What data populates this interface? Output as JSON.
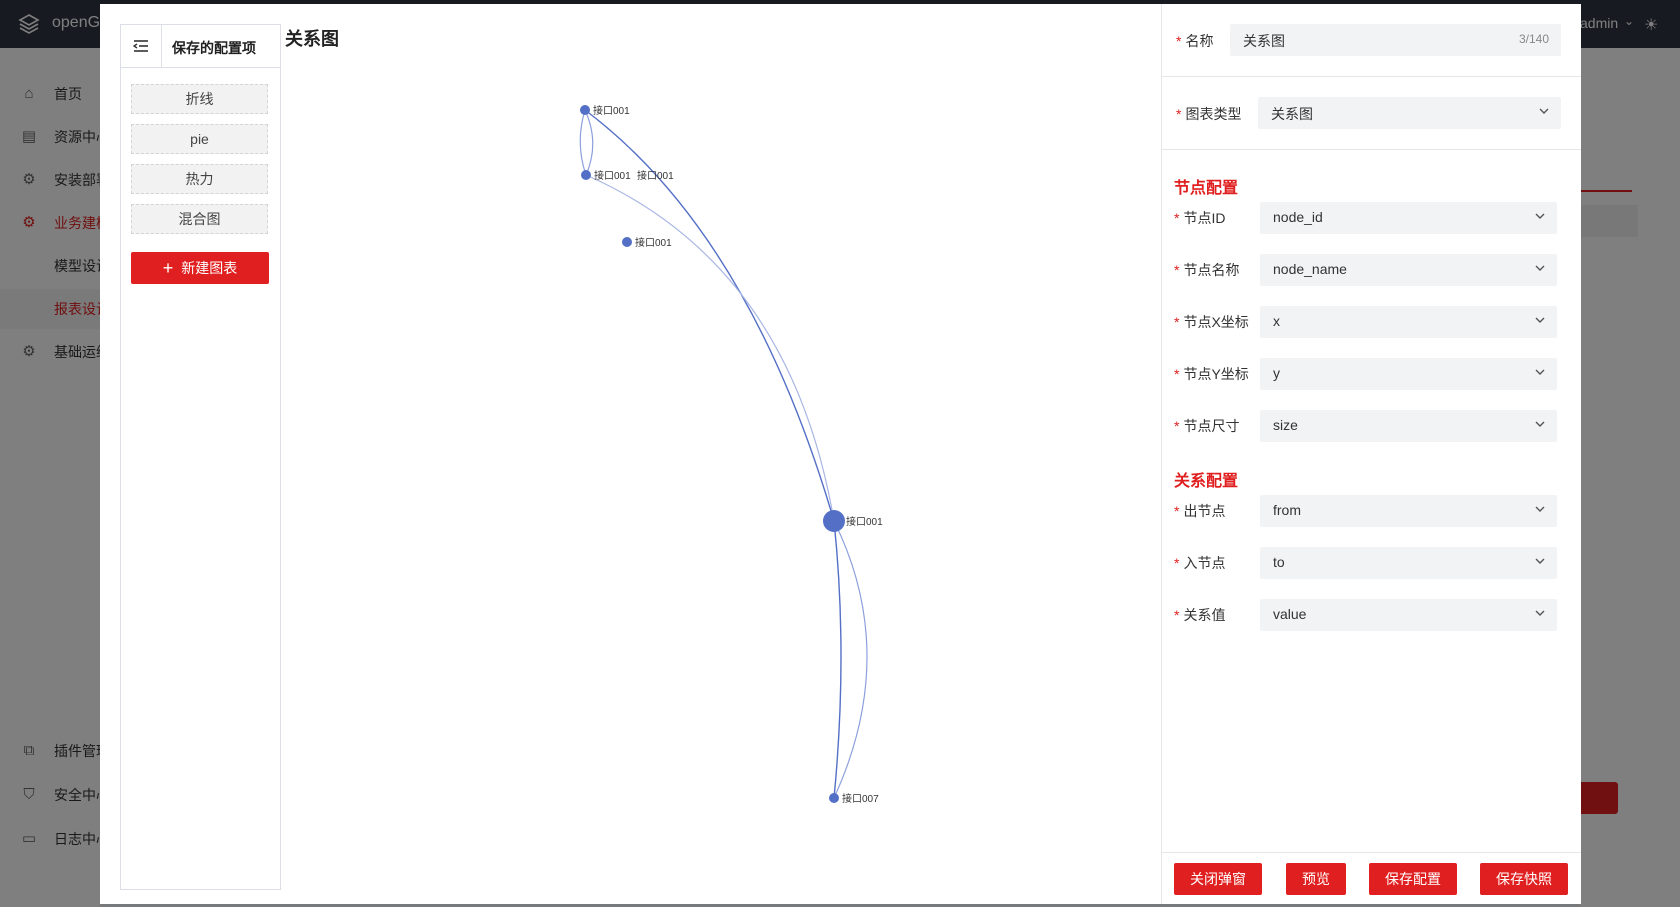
{
  "app": {
    "logo_text": "openG",
    "user": "admin"
  },
  "sidebar": {
    "items": [
      {
        "label": "首页",
        "icon": "home-icon"
      },
      {
        "label": "资源中心",
        "icon": "resource-icon"
      },
      {
        "label": "安装部署",
        "icon": "gear-icon"
      },
      {
        "label": "业务建模",
        "icon": "gear-icon"
      },
      {
        "label": "模型设计",
        "icon": ""
      },
      {
        "label": "报表设计",
        "icon": ""
      },
      {
        "label": "基础运维",
        "icon": "gear-icon"
      },
      {
        "label": "插件管理",
        "icon": "plugin-icon"
      },
      {
        "label": "安全中心",
        "icon": "shield-icon"
      },
      {
        "label": "日志中心",
        "icon": "log-icon"
      }
    ]
  },
  "config_panel": {
    "title": "保存的配置项",
    "items": [
      "折线",
      "pie",
      "热力",
      "混合图"
    ],
    "new_button": "新建图表"
  },
  "chart_title": "关系图",
  "chart_data": {
    "type": "graph",
    "nodes": [
      {
        "label": "接口001"
      },
      {
        "label": "接口001"
      },
      {
        "label": "接口001"
      },
      {
        "label": "接口001"
      },
      {
        "label": "接口001"
      },
      {
        "label": "接口007"
      }
    ]
  },
  "form": {
    "name_label": "名称",
    "name_value": "关系图",
    "name_count": "3/140",
    "chart_type_label": "图表类型",
    "chart_type_value": "关系图",
    "node_section": "节点配置",
    "node_fields": [
      {
        "label": "节点ID",
        "value": "node_id"
      },
      {
        "label": "节点名称",
        "value": "node_name"
      },
      {
        "label": "节点X坐标",
        "value": "x"
      },
      {
        "label": "节点Y坐标",
        "value": "y"
      },
      {
        "label": "节点尺寸",
        "value": "size"
      }
    ],
    "relation_section": "关系配置",
    "relation_fields": [
      {
        "label": "出节点",
        "value": "from"
      },
      {
        "label": "入节点",
        "value": "to"
      },
      {
        "label": "关系值",
        "value": "value"
      }
    ]
  },
  "buttons": {
    "close": "关闭弹窗",
    "preview": "预览",
    "save_config": "保存配置",
    "save_snapshot": "保存快照"
  },
  "colors": {
    "accent": "#e02020",
    "node": "#5470c6",
    "topbar": "#2f3542"
  }
}
